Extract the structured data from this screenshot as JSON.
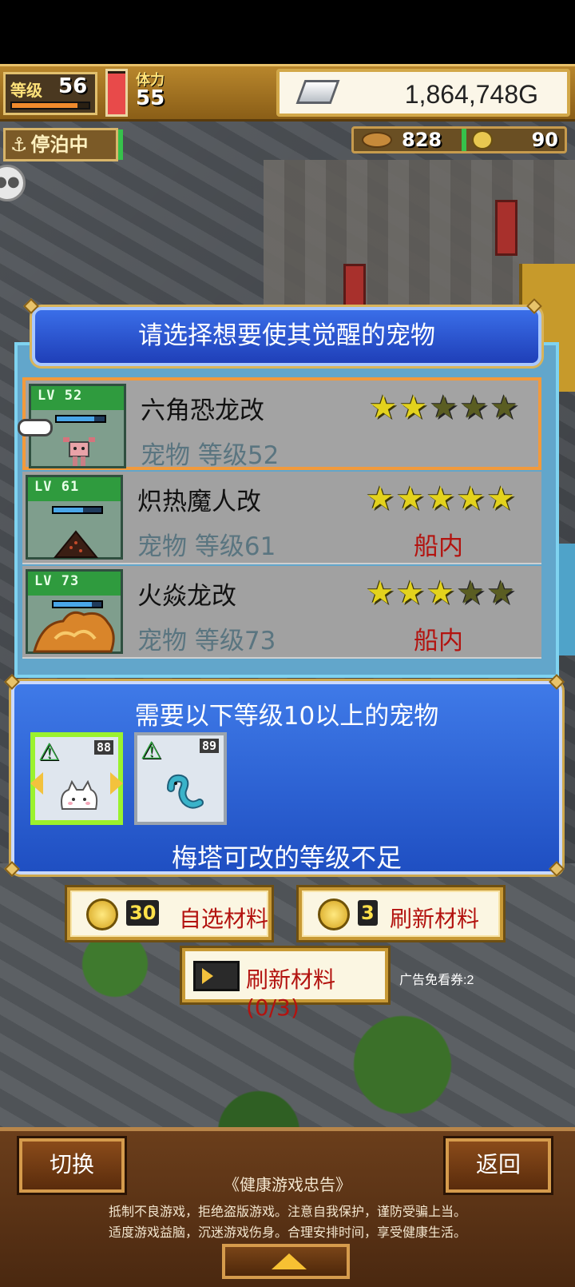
{
  "hud": {
    "level_label": "等级",
    "level_value": "56",
    "xp_progress": 0.85,
    "stamina_label": "体力",
    "stamina_value": "55",
    "stamina_progress": 0.95,
    "gold": "1,864,748G",
    "dock_status": "停泊中",
    "resource_a": "828",
    "resource_b": "90"
  },
  "dialog": {
    "title": "请选择想要使其觉醒的宠物",
    "pets": [
      {
        "lv": "LV 52",
        "name": "六角恐龙改",
        "sub": "宠物 等级52",
        "location": "",
        "stars": [
          1,
          1,
          0,
          0,
          0
        ],
        "selected": true
      },
      {
        "lv": "LV 61",
        "name": "炽热魔人改",
        "sub": "宠物 等级61",
        "location": "船内",
        "stars": [
          1,
          1,
          1,
          1,
          1
        ],
        "selected": false
      },
      {
        "lv": "LV 73",
        "name": "火焱龙改",
        "sub": "宠物 等级73",
        "location": "船内",
        "stars": [
          1,
          1,
          1,
          0,
          0
        ],
        "selected": false
      }
    ]
  },
  "requirement": {
    "title": "需要以下等级10以上的宠物",
    "cards": [
      {
        "num": "88",
        "warn": "⚠"
      },
      {
        "num": "89",
        "warn": "⚠"
      }
    ],
    "footer": "梅塔可改的等级不足"
  },
  "actions": {
    "select_qty": "30",
    "select_label": "自选材料",
    "refresh_qty": "3",
    "refresh_label": "刷新材料",
    "ad_label": "刷新材料(0/3)",
    "ad_note": "广告免看券:2"
  },
  "bottom": {
    "switch_label": "切换",
    "back_label": "返回",
    "health_title": "《健康游戏忠告》",
    "health_line1": "抵制不良游戏，拒绝盗版游戏。注意自我保护，谨防受骗上当。",
    "health_line2": "适度游戏益脑，沉迷游戏伤身。合理安排时间，享受健康生活。"
  },
  "colors": {
    "accent_blue": "#2f5fd8",
    "selected_border": "#f29a3c",
    "location_red": "#b3130f",
    "star_on": "#e3d21d"
  }
}
